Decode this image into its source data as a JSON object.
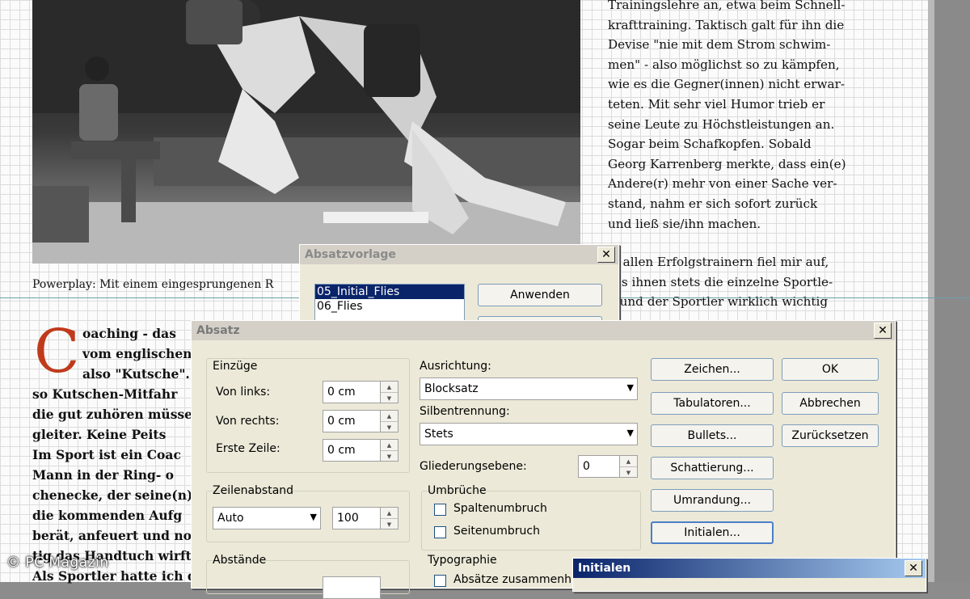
{
  "document": {
    "caption": "Powerplay: Mit einem eingesprungenen R",
    "right_column_lines_1": [
      "Trainingslehre an, etwa beim Schnell-",
      "krafttraining. Taktisch galt für ihn die",
      "Devise \"nie mit dem Strom schwim-",
      "men\" - also möglichst so zu kämpfen,",
      "wie es die Gegner(innen) nicht erwar-",
      "teten. Mit sehr viel Humor trieb er",
      "seine Leute zu Höchstleistungen an.",
      "Sogar beim Schafkopfen. Sobald",
      "Georg Karrenberg merkte, dass ein(e)",
      "Andere(r) mehr von einer Sache ver-",
      "stand, nahm er sich sofort zurück",
      "und ließ sie/ihn machen."
    ],
    "right_column_lines_2": [
      "ei allen Erfolgstrainern fiel mir auf,",
      "ass ihnen stets die einzelne Sportle-",
      "n und der Sportler wirklich wichtig"
    ],
    "drop_cap": "C",
    "left_column_lines": [
      "oaching - das",
      "vom englischen",
      "also \"Kutsche\".",
      "so Kutschen-Mitfahr",
      "die gut zuhören müsse",
      "gleiter. Keine Peits",
      "Im Sport ist ein Coac",
      "Mann in der Ring- o",
      "chenecke, der seine(n)",
      "die kommenden Aufg",
      "berät, anfeuert und no",
      "tig das Handtuch wirft",
      "Als Sportler hatte ich d"
    ],
    "watermark": "© PC Magazin"
  },
  "absatzvorlage_dialog": {
    "title": "Absatzvorlage",
    "close": "✕",
    "styles": [
      "05_Initial_Flies",
      "06_Flies"
    ],
    "selected_index": 0,
    "apply_button": "Anwenden"
  },
  "absatz_dialog": {
    "title": "Absatz",
    "close": "✕",
    "einzuege": {
      "label": "Einzüge",
      "von_links_label": "Von links:",
      "von_links_value": "0 cm",
      "von_rechts_label": "Von rechts:",
      "von_rechts_value": "0 cm",
      "erste_zeile_label": "Erste Zeile:",
      "erste_zeile_value": "0 cm"
    },
    "zeilenabstand": {
      "label": "Zeilenabstand",
      "mode": "Auto",
      "value": "100"
    },
    "abstaende_label": "Abstände",
    "ausrichtung": {
      "label": "Ausrichtung:",
      "value": "Blocksatz"
    },
    "silbentrennung": {
      "label": "Silbentrennung:",
      "value": "Stets"
    },
    "gliederungsebene": {
      "label": "Gliederungsebene:",
      "value": "0"
    },
    "umbrueche": {
      "label": "Umbrüche",
      "spaltenumbruch": "Spaltenumbruch",
      "seitenumbruch": "Seitenumbruch"
    },
    "typographie": {
      "label": "Typographie",
      "absaetze": "Absätze zusammenh"
    },
    "buttons": {
      "zeichen": "Zeichen...",
      "tabulatoren": "Tabulatoren...",
      "bullets": "Bullets...",
      "schattierung": "Schattierung...",
      "umrandung": "Umrandung...",
      "initialen": "Initialen...",
      "ok": "OK",
      "abbrechen": "Abbrechen",
      "zuruecksetzen": "Zurücksetzen"
    }
  },
  "initialen_dialog": {
    "title": "Initialen",
    "close": "✕"
  },
  "icons": {
    "spin_up": "▲",
    "spin_down": "▼",
    "combo_arrow": "▼"
  }
}
